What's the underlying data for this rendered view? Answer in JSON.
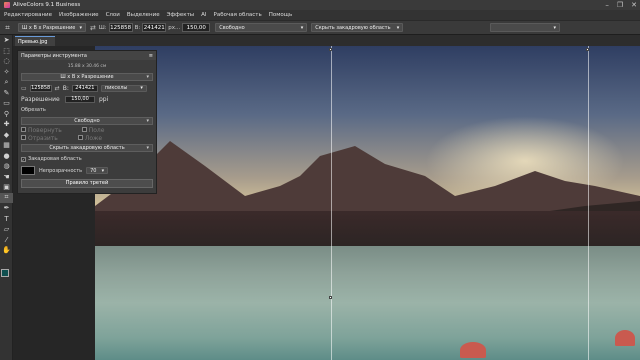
{
  "titlebar": {
    "title": "AliveColors 9.1 Business",
    "minimize": "–",
    "maximize": "❐",
    "close": "✕"
  },
  "menu": [
    "Редактирование",
    "Изображение",
    "Слои",
    "Выделение",
    "Эффекты",
    "AI",
    "Рабочая область",
    "Помощь"
  ],
  "options": {
    "mode": "Ш х В х Разрешение",
    "w_label": "Ш:",
    "w_value": "125858",
    "h_label": "В:",
    "h_value": "241421",
    "res_unit": "px...",
    "res_value": "150,00",
    "ratio": "Свободно",
    "hide_area": "Скрыть закадровую область"
  },
  "tab": {
    "label": "Превью.jpg"
  },
  "panel": {
    "title": "Параметры инструмента",
    "size_info": "15.88 x 30.46 см",
    "mode": "Ш х В х Разрешение",
    "w_value": "125858",
    "h_label": "В:",
    "h_value": "241421",
    "unit": "пикселы",
    "res_label": "Разрешение",
    "res_value": "150,00",
    "res_unit": "ppi",
    "crop_label": "Обрезать",
    "ratio": "Свободно",
    "opt1": "Повернуть",
    "opt2": "Поле",
    "opt3": "Отразить",
    "opt4": "Ложе",
    "hide_area": "Скрыть закадровую область",
    "offscreen_label": "Закадровая область",
    "opacity_label": "Непрозрачность",
    "opacity_value": "70",
    "rule_button": "Правило третей"
  },
  "colors": {
    "foreground": "#0f4f4f",
    "background": "#ffffff",
    "accent": "#6a9bd8"
  }
}
